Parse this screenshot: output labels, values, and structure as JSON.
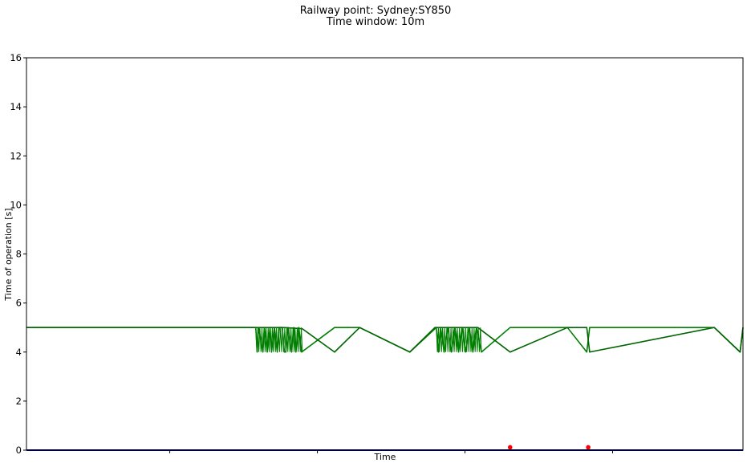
{
  "chart_data": {
    "type": "line",
    "title": [
      "Railway point: Sydney:SY850",
      "Time window: 10m"
    ],
    "xlabel": "Time",
    "ylabel": "Time of operation [s]",
    "ylim": [
      0,
      16
    ],
    "yticks": [
      0,
      2,
      4,
      6,
      8,
      10,
      12,
      14,
      16
    ],
    "xlim": [
      0,
      100
    ],
    "grid": false,
    "colors": {
      "series": "#007f00",
      "trend": "#006400",
      "baseline": "#00007f",
      "anomaly": "#ff0000"
    },
    "series": [
      {
        "values_x": [
          0,
          32,
          32.2,
          32.4,
          33,
          33.2,
          33.6,
          34,
          34.2,
          34.6,
          35,
          35.3,
          35.7,
          36,
          36.2,
          36.5,
          37,
          37.3,
          37.6,
          38.0,
          38.4,
          43,
          46.5,
          53.5,
          57.2,
          57.5,
          57.8,
          58.3,
          58.8,
          59.3,
          59.8,
          60.3,
          60.8,
          61.3,
          61.8,
          62.3,
          62.8,
          63.5,
          67.5,
          75.5,
          78.2,
          78.6,
          96,
          99.6,
          100
        ],
        "values_y": [
          5,
          5,
          4,
          5,
          4,
          5,
          4,
          5,
          4,
          5,
          4,
          5,
          5,
          4,
          4,
          5,
          4,
          5,
          4,
          5,
          4,
          5,
          5,
          4,
          5,
          4,
          5,
          4,
          5,
          4,
          5,
          4,
          5,
          4,
          5,
          4,
          5,
          4,
          5,
          5,
          4,
          5,
          5,
          4,
          5
        ]
      },
      {
        "values_x": [
          0,
          36,
          38.5,
          43,
          46.5,
          53.5,
          57,
          63,
          67.5,
          75.5,
          78.2,
          78.6,
          96,
          99.6,
          100
        ],
        "values_y": [
          5,
          5,
          4.95,
          4,
          5,
          4,
          5,
          5,
          4,
          5,
          5,
          4,
          5,
          4,
          5
        ]
      },
      {
        "values_x": [
          0,
          100
        ],
        "values_y": [
          0,
          0
        ]
      }
    ],
    "anomalies": {
      "x": [
        67.5,
        78.4
      ],
      "y": [
        0.05,
        0.05
      ]
    },
    "xtick_positions": [
      20,
      40.6,
      61.2,
      81.8
    ]
  }
}
